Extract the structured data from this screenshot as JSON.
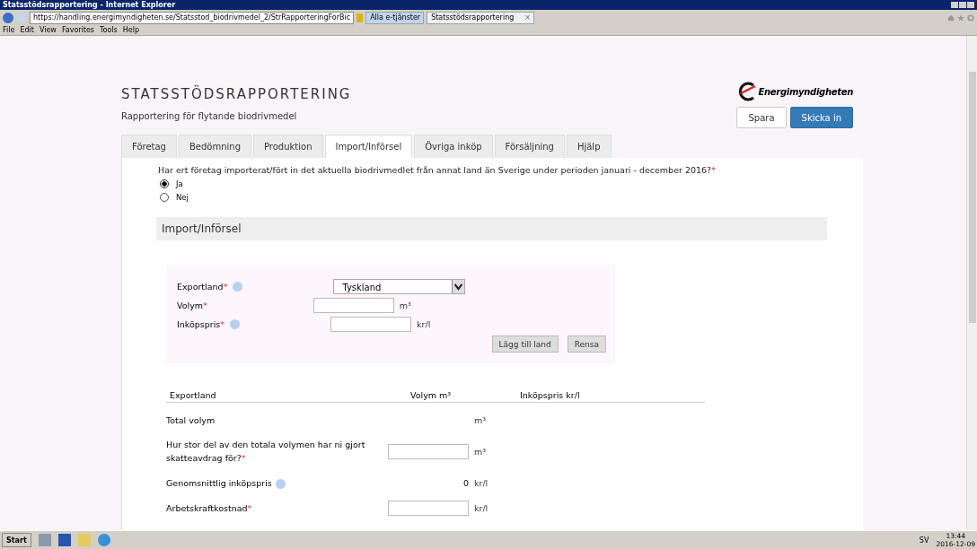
{
  "browser": {
    "title": "Statsstödsrapportering - Internet Explorer",
    "url": "https://handling.energimyndigheten.se/Statsstod_biodrivmedel_2/StrRapporteringForBic",
    "tabs": [
      {
        "label": "Alla e-tjänster",
        "selected": false
      },
      {
        "label": "Statsstödsrapportering",
        "selected": true
      }
    ],
    "tab_close": "×",
    "menu": [
      "File",
      "Edit",
      "View",
      "Favorites",
      "Tools",
      "Help"
    ]
  },
  "header": {
    "title": "STATSSTÖDSRAPPORTERING",
    "subtitle": "Rapportering för flytande biodrivmedel",
    "logo": "Energimyndigheten",
    "buttons": [
      {
        "label": "Spara",
        "primary": false
      },
      {
        "label": "Skicka in",
        "primary": true
      }
    ]
  },
  "tabs": [
    {
      "label": "Företag",
      "selected": false
    },
    {
      "label": "Bedömning",
      "selected": false
    },
    {
      "label": "Produktion",
      "selected": false
    },
    {
      "label": "Import/Införsel",
      "selected": true
    },
    {
      "label": "Övriga inköp",
      "selected": false
    },
    {
      "label": "Försäljning",
      "selected": false
    },
    {
      "label": "Hjälp",
      "selected": false
    }
  ],
  "question": {
    "text": "Har ert företag importerat/fört in det aktuella biodrivmedlet från annat land än Sverige under perioden januari - december 2016?",
    "marker": "*",
    "options": [
      {
        "label": "Ja",
        "selected": true
      },
      {
        "label": "Nej",
        "selected": false
      }
    ]
  },
  "section": {
    "title": "Import/Införsel",
    "fields": [
      {
        "label": "Exportland",
        "marker": "*",
        "info": true,
        "kind": "select",
        "value": "Tyskland"
      },
      {
        "label": "Volym",
        "marker": "*",
        "info": false,
        "kind": "input",
        "unit": "m³"
      },
      {
        "label": "Inköpspris",
        "marker": "*",
        "info": true,
        "kind": "input",
        "unit": "kr/l"
      }
    ],
    "buttons": [
      "Lägg till land",
      "Rensa"
    ],
    "columns": [
      "Exportland",
      "Volym m³",
      "Inköpspris kr/l"
    ],
    "summary": [
      {
        "label": "Total volym",
        "info": false,
        "kind": "value",
        "unit": "m³"
      },
      {
        "label": "Hur stor del av den totala volymen har ni gjort skatteavdrag för?",
        "marker": "*",
        "info": false,
        "kind": "input",
        "unit": "m³"
      },
      {
        "label": "Genomsnittlig inköpspris",
        "info": true,
        "kind": "value",
        "value": "0",
        "unit": "kr/l"
      },
      {
        "label": "Arbetskraftkostnad",
        "marker": "*",
        "info": false,
        "kind": "input",
        "unit": "kr/l"
      }
    ]
  },
  "taskbar": {
    "start": "Start",
    "lang": "SV",
    "time": "13:44",
    "date": "2016-12-09"
  }
}
